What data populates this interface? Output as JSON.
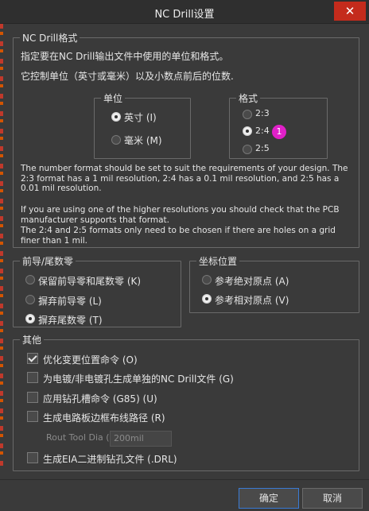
{
  "window": {
    "title": "NC Drill设置",
    "close_glyph": "✕"
  },
  "format_group": {
    "legend": "NC Drill格式",
    "desc1": "指定要在NC Drill输出文件中使用的单位和格式。",
    "desc2": "它控制单位（英寸或毫米）以及小数点前后的位数.",
    "units": {
      "legend": "单位",
      "options": [
        {
          "label": "英寸 (I)",
          "checked": true
        },
        {
          "label": "毫米 (M)",
          "checked": false
        }
      ]
    },
    "format": {
      "legend": "格式",
      "options": [
        {
          "label": "2:3",
          "checked": false
        },
        {
          "label": "2:4",
          "checked": true
        },
        {
          "label": "2:5",
          "checked": false
        }
      ],
      "badge": "1"
    },
    "note1": "The number format should be set to suit the requirements of your design. The 2:3 format has a 1 mil resolution, 2:4 has a 0.1 mil resolution, and 2:5 has a 0.01 mil resolution.",
    "note2": "If you are using one of the higher resolutions you should check that the PCB manufacturer supports that format.",
    "note3": "The 2:4 and 2:5 formats only need to be chosen if there are holes on a grid finer than 1 mil."
  },
  "zeros_group": {
    "legend": "前导/尾数零",
    "options": [
      {
        "label": "保留前导零和尾数零 (K)",
        "checked": false
      },
      {
        "label": "摒弃前导零 (L)",
        "checked": false
      },
      {
        "label": "摒弃尾数零 (T)",
        "checked": true
      }
    ]
  },
  "coord_group": {
    "legend": "坐标位置",
    "options": [
      {
        "label": "参考绝对原点 (A)",
        "checked": false
      },
      {
        "label": "参考相对原点 (V)",
        "checked": true
      }
    ]
  },
  "other_group": {
    "legend": "其他",
    "options": [
      {
        "label": "优化变更位置命令 (O)",
        "checked": true
      },
      {
        "label": "为电镀/非电镀孔生成单独的NC Drill文件 (G)",
        "checked": false
      },
      {
        "label": "应用钻孔槽命令 (G85) (U)",
        "checked": false
      },
      {
        "label": "生成电路板边框布线路径 (R)",
        "checked": false
      }
    ],
    "rout_tool_label": "Rout Tool  Dia (",
    "rout_tool_value": "200mil",
    "eia_label": "生成EIA二进制钻孔文件 (.DRL)"
  },
  "buttons": {
    "ok": "确定",
    "cancel": "取消"
  },
  "colors": {
    "accent": "#3a7bd5",
    "badge": "#e020c8",
    "close": "#c42b1c"
  }
}
